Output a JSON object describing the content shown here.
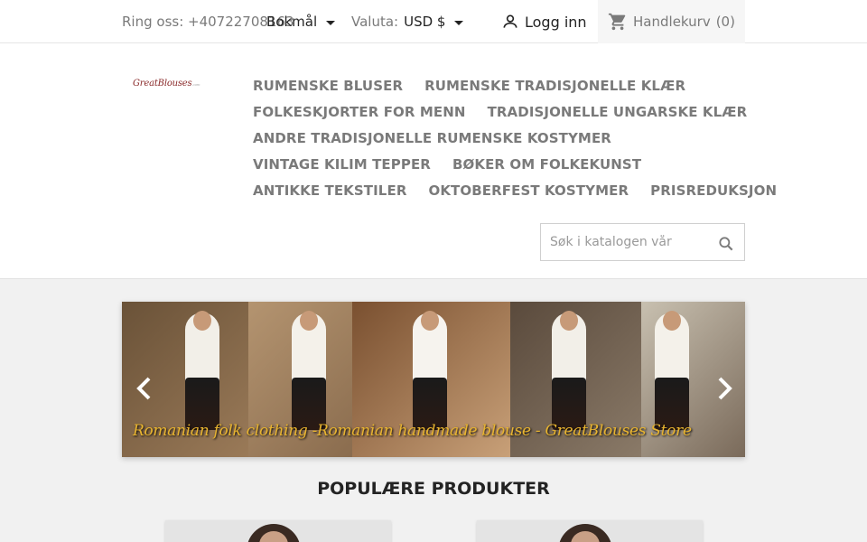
{
  "topbar": {
    "call_text": "Ring oss: +40722708163",
    "language": "Bokmål",
    "currency_label": "Valuta:",
    "currency_value": "USD $",
    "login_label": "Logg inn",
    "cart_label": "Handlekurv",
    "cart_count": "(0)"
  },
  "logo": {
    "text": "GreatBlouses",
    "suffix": ".com"
  },
  "nav": {
    "rows": [
      [
        "RUMENSKE BLUSER",
        "RUMENSKE TRADISJONELLE KLÆR"
      ],
      [
        "FOLKESKJORTER FOR MENN",
        "TRADISJONELLE UNGARSKE KLÆR"
      ],
      [
        "ANDRE TRADISJONELLE RUMENSKE KOSTYMER"
      ],
      [
        "VINTAGE KILIM TEPPER",
        "BØKER OM FOLKEKUNST"
      ],
      [
        "ANTIKKE TEKSTILER",
        "OKTOBERFEST KOSTYMER",
        "PRISREDUKSJON"
      ]
    ]
  },
  "search": {
    "placeholder": "Søk i katalogen vår"
  },
  "carousel": {
    "caption": "Romanian folk clothing -Romanian handmade blouse - GreatBlouses Store",
    "panel_colors": [
      "#8a6a4a",
      "#a8845c",
      "#b88a58",
      "#6e5a48",
      "#9c8c78"
    ]
  },
  "popular": {
    "title": "POPULÆRE PRODUKTER"
  },
  "colors": {
    "text": "#7a7a7a",
    "dark": "#232323",
    "caption": "#e8b430"
  }
}
